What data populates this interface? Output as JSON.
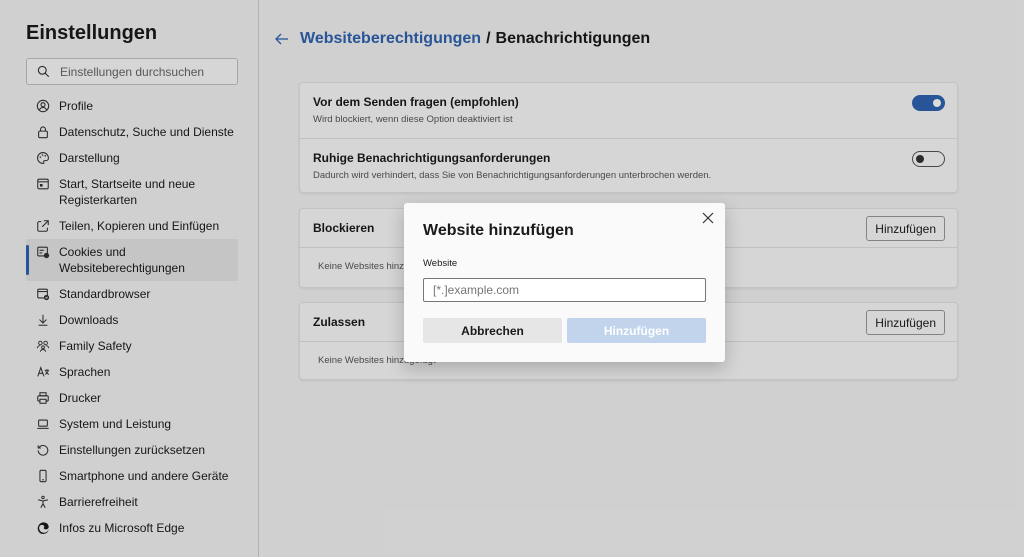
{
  "sidebar": {
    "title": "Einstellungen",
    "search_placeholder": "Einstellungen durchsuchen",
    "items": [
      {
        "label": "Profile",
        "icon": "profile-icon"
      },
      {
        "label": "Datenschutz, Suche und Dienste",
        "icon": "lock-icon"
      },
      {
        "label": "Darstellung",
        "icon": "palette-icon"
      },
      {
        "label": "Start, Startseite und neue Registerkarten",
        "icon": "window-icon"
      },
      {
        "label": "Teilen, Kopieren und Einfügen",
        "icon": "share-icon"
      },
      {
        "label": "Cookies und Websiteberechtigungen",
        "icon": "cookies-icon",
        "active": true
      },
      {
        "label": "Standardbrowser",
        "icon": "browser-icon"
      },
      {
        "label": "Downloads",
        "icon": "download-icon"
      },
      {
        "label": "Family Safety",
        "icon": "family-icon"
      },
      {
        "label": "Sprachen",
        "icon": "language-icon"
      },
      {
        "label": "Drucker",
        "icon": "printer-icon"
      },
      {
        "label": "System und Leistung",
        "icon": "laptop-icon"
      },
      {
        "label": "Einstellungen zurücksetzen",
        "icon": "reset-icon"
      },
      {
        "label": "Smartphone und andere Geräte",
        "icon": "phone-icon"
      },
      {
        "label": "Barrierefreiheit",
        "icon": "accessibility-icon"
      },
      {
        "label": "Infos zu Microsoft Edge",
        "icon": "edge-logo-icon"
      }
    ]
  },
  "header": {
    "breadcrumb_link": "Websiteberechtigungen",
    "separator": "/",
    "current": "Benachrichtigungen"
  },
  "settings": {
    "ask_title": "Vor dem Senden fragen (empfohlen)",
    "ask_desc": "Wird blockiert, wenn diese Option deaktiviert ist",
    "ask_enabled": true,
    "quiet_title": "Ruhige Benachrichtigungsanforderungen",
    "quiet_desc": "Dadurch wird verhindert, dass Sie von Benachrichtigungsanforderungen unterbrochen werden.",
    "quiet_enabled": false
  },
  "block_section": {
    "title": "Blockieren",
    "add_label": "Hinzufügen",
    "empty_text": "Keine Websites hinzugefügt"
  },
  "allow_section": {
    "title": "Zulassen",
    "add_label": "Hinzufügen",
    "empty_text": "Keine Websites hinzugefügt"
  },
  "dialog": {
    "title": "Website hinzufügen",
    "field_label": "Website",
    "input_placeholder": "[*.]example.com",
    "input_value": "",
    "cancel_label": "Abbrechen",
    "add_label": "Hinzufügen"
  },
  "colors": {
    "accent": "#2f63b1",
    "background": "#f3f3f3",
    "card": "#fafafa",
    "disabled_button": "#c2d4ec"
  }
}
